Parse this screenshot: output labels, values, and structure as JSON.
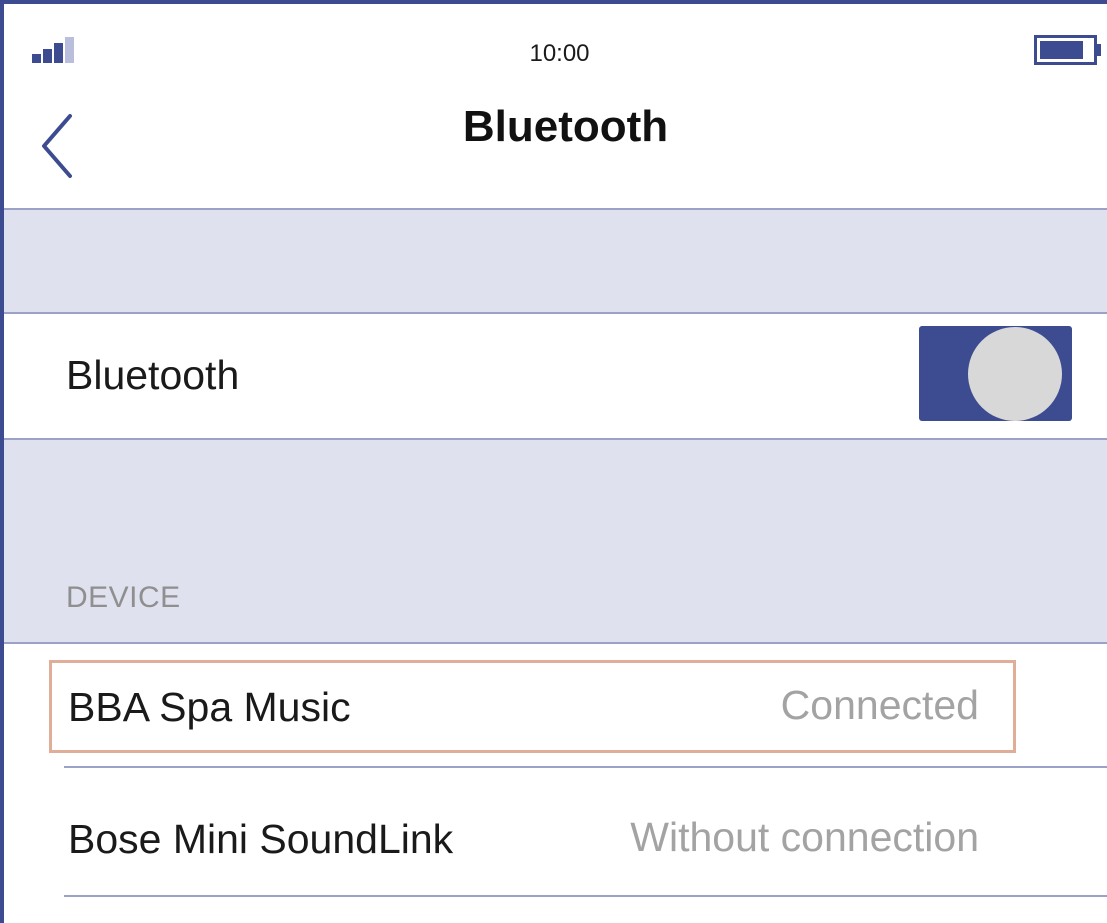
{
  "status_bar": {
    "time": "10:00",
    "signal_icon": "signal-bars-icon",
    "battery_icon": "battery-icon"
  },
  "nav": {
    "back_icon": "chevron-left-icon",
    "title": "Bluetooth"
  },
  "bluetooth_setting": {
    "label": "Bluetooth",
    "enabled": true
  },
  "devices_section": {
    "header": "DEVICE",
    "items": [
      {
        "name": "BBA Spa Music",
        "status": "Connected",
        "highlighted": true
      },
      {
        "name": "Bose Mini SoundLink",
        "status": "Without connection",
        "highlighted": false
      }
    ]
  },
  "colors": {
    "accent": "#3d4c90",
    "group_background": "#dfe2ee",
    "separator": "#9aa2c8",
    "highlight_border": "#e0ad98",
    "secondary_text": "#a3a3a3"
  }
}
